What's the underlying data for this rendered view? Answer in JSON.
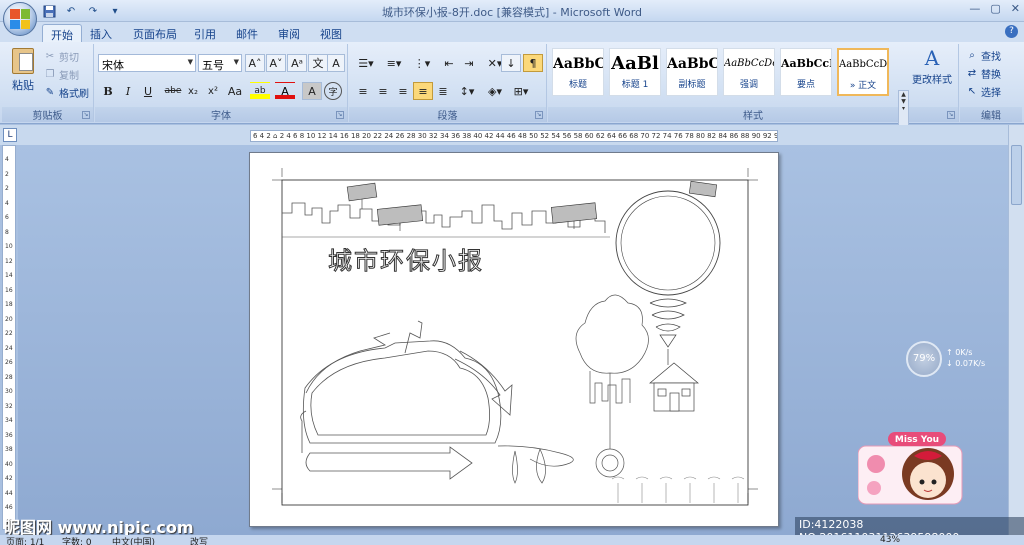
{
  "window": {
    "title": "城市环保小报-8开.doc [兼容模式] - Microsoft Word",
    "controls": [
      "—",
      "▢",
      "✕"
    ]
  },
  "quick_access": {
    "save_icon": "save-icon",
    "undo_icon": "undo-icon",
    "redo_icon": "redo-icon",
    "customize_label": "▾"
  },
  "tabs": [
    "开始",
    "插入",
    "页面布局",
    "引用",
    "邮件",
    "审阅",
    "视图"
  ],
  "active_tab": "开始",
  "clipboard": {
    "paste_label": "粘贴",
    "cut_label": "剪切",
    "copy_label": "复制",
    "format_painter_label": "格式刷",
    "group_label": "剪贴板"
  },
  "font": {
    "font_name": "宋体",
    "font_size": "五号",
    "group_label": "字体",
    "grow": "A˄",
    "shrink": "A˅",
    "clear": "Aᵃ",
    "phonetic": "文",
    "border_char": "A",
    "bold": "B",
    "italic": "I",
    "underline": "U",
    "strike": "abe",
    "subscript": "x₂",
    "superscript": "x²",
    "change_case": "Aa",
    "highlight": "ab",
    "font_color": "A",
    "char_shading": "A",
    "enclose": "字"
  },
  "paragraph": {
    "group_label": "段落"
  },
  "styles": {
    "group_label": "样式",
    "items": [
      {
        "sample": "AaBbC",
        "name": "标题"
      },
      {
        "sample": "AaBl",
        "name": "标题 1"
      },
      {
        "sample": "AaBbC",
        "name": "副标题"
      },
      {
        "sample": "AaBbCcDc",
        "name": "强调"
      },
      {
        "sample": "AaBbCcD",
        "name": "要点"
      },
      {
        "sample": "AaBbCcDc",
        "name": "» 正文"
      }
    ],
    "change_styles_label": "更改样式"
  },
  "editing": {
    "group_label": "编辑",
    "find_label": "查找",
    "replace_label": "替换",
    "select_label": "选择"
  },
  "ruler": {
    "corner_symbol": "L",
    "ticks": "6 4 2 ⌂ 2 4 6 8 10 12 14 16 18 20 22 24 26 28 30 32 34 36 38 40 42 44 46 48 50 52 54 56 58 60 62 64 66 68 70 72 74 76 78 80 82 84 86 88 90 92 94 96 98 △ 102104106",
    "vertical_ticks": [
      "4",
      "2",
      "2",
      "4",
      "6",
      "8",
      "10",
      "12",
      "14",
      "16",
      "18",
      "20",
      "22",
      "24",
      "26",
      "28",
      "30",
      "32",
      "34",
      "36",
      "38",
      "40",
      "42",
      "44",
      "46",
      "48"
    ]
  },
  "document": {
    "newspaper_title": "城市环保小报"
  },
  "statusbar": {
    "page": "页面: 1/1",
    "words": "字数: 0",
    "language": "中文(中国)",
    "mode": "改写",
    "zoom": "43%"
  },
  "net_speed": {
    "percent": "79%",
    "up": "0K/s",
    "down": "0.07K/s"
  },
  "sticker": {
    "text": "Miss You"
  },
  "watermark": {
    "site": "昵图网 www.nipic.com",
    "id": "ID:4122038 NO:20161103113639598000"
  }
}
